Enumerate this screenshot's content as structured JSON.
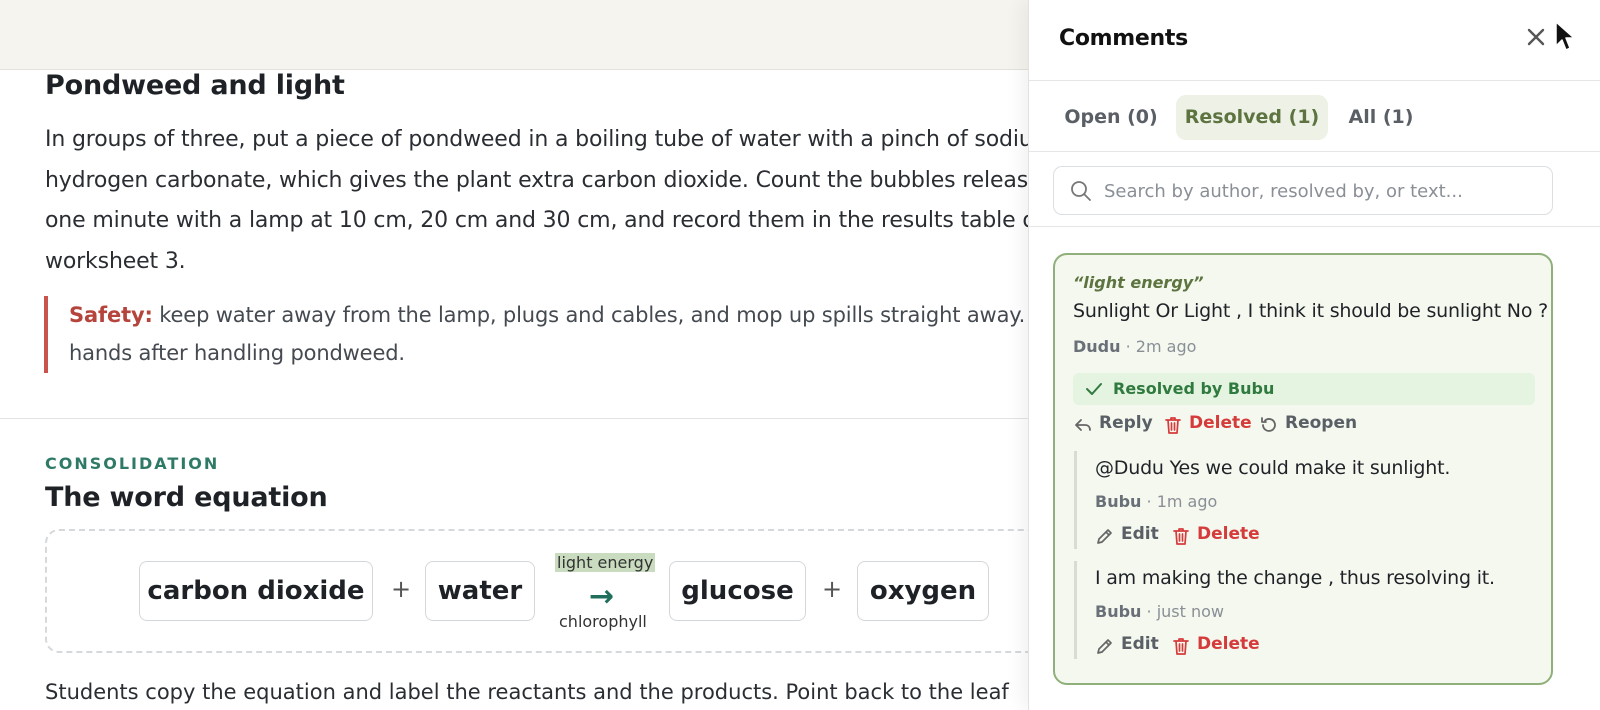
{
  "document": {
    "section1_title": "Pondweed and light",
    "paragraph_lines": [
      "In groups of three, put a piece of pondweed in a boiling tube of water with a pinch of sodium",
      "hydrogen carbonate, which gives the plant extra carbon dioxide. Count the bubbles released in",
      "one minute with a lamp at 10 cm, 20 cm and 30 cm, and record them in the results table on",
      "worksheet 3."
    ],
    "safety_label": "Safety:",
    "safety_line1": " keep water away from the lamp, plugs and cables, and mop up spills straight away. Wash",
    "safety_line2": "hands after handling pondweed.",
    "eyebrow": "CONSOLIDATION",
    "section2_title": "The word equation",
    "equation": {
      "term1": "carbon dioxide",
      "plus1": "+",
      "term2": "water",
      "arrow_top": "light energy",
      "arrow_symbol": "→",
      "arrow_bottom": "chlorophyll",
      "term3": "glucose",
      "plus2": "+",
      "term4": "oxygen"
    },
    "cutoff_text": "Students copy the equation and label the reactants and the products. Point back to the leaf"
  },
  "comments_panel": {
    "title": "Comments",
    "tabs": [
      {
        "label": "Open (0)",
        "active": false
      },
      {
        "label": "Resolved (1)",
        "active": true
      },
      {
        "label": "All (1)",
        "active": false
      }
    ],
    "search_placeholder": "Search by author, resolved by, or text...",
    "thread": {
      "quote": "“light energy”",
      "body": "Sunlight Or Light , I think it should be sunlight No ?",
      "author": "Dudu",
      "time": "· 2m ago",
      "resolved_text": "Resolved by Bubu",
      "actions": {
        "reply": "Reply",
        "delete": "Delete",
        "reopen": "Reopen"
      },
      "replies": [
        {
          "body": "@Dudu Yes we could make it sunlight.",
          "author": "Bubu",
          "time": "· 1m ago",
          "edit": "Edit",
          "delete": "Delete"
        },
        {
          "body": "I am making the change , thus resolving it.",
          "author": "Bubu",
          "time": "· just now",
          "edit": "Edit",
          "delete": "Delete"
        }
      ]
    }
  },
  "colors": {
    "accent_green": "#5d7440",
    "eyebrow_teal": "#2f7a66",
    "danger_red": "#d63b3b",
    "safety_red": "#b5443d"
  },
  "icons": [
    "close-icon",
    "search-icon",
    "check-icon",
    "reply-icon",
    "trash-icon",
    "reopen-icon",
    "pencil-icon",
    "mouse-cursor-icon"
  ]
}
